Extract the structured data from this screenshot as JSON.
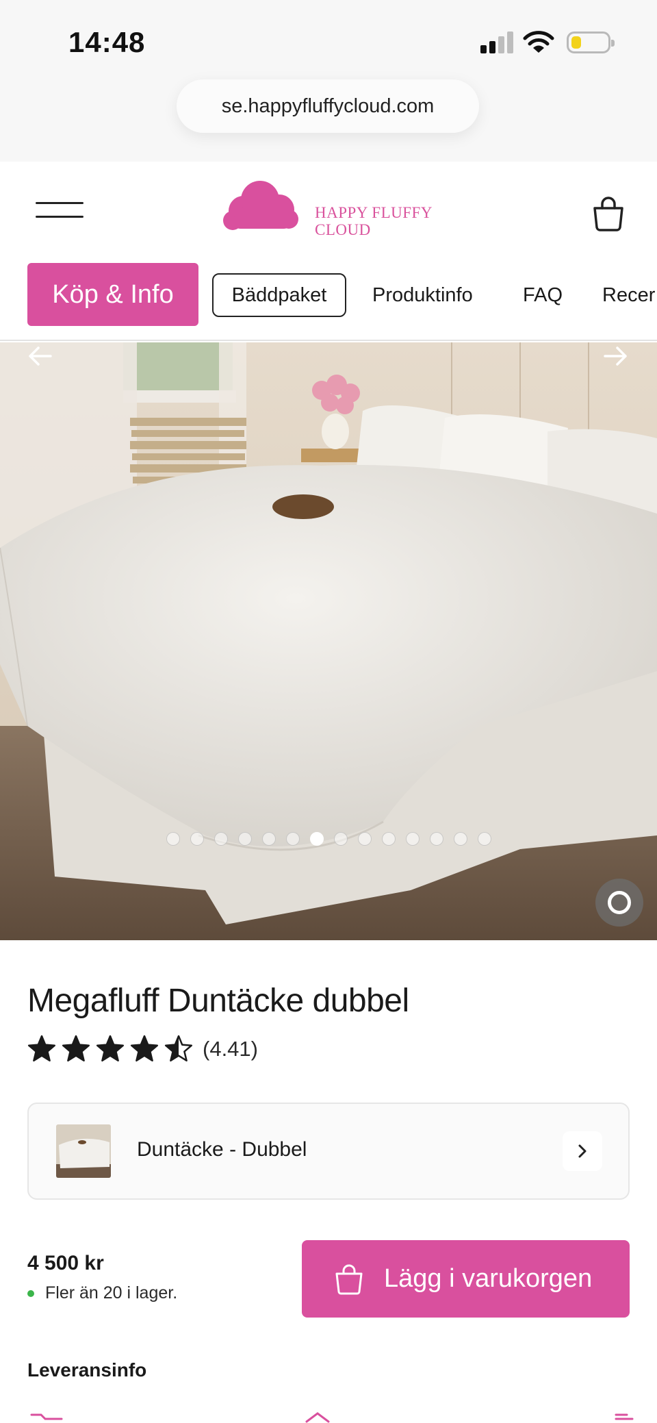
{
  "status_bar": {
    "time": "14:48"
  },
  "browser": {
    "url": "se.happyfluffycloud.com"
  },
  "header": {
    "logo_line1": "HAPPY FLUFFY",
    "logo_line2": "CLOUD",
    "brand_color": "#d9509e"
  },
  "tabs": [
    {
      "label": "Köp & Info",
      "state": "active"
    },
    {
      "label": "Bäddpaket",
      "state": "outlined"
    },
    {
      "label": "Produktinfo",
      "state": "normal"
    },
    {
      "label": "FAQ",
      "state": "normal"
    },
    {
      "label": "Recer",
      "state": "normal"
    }
  ],
  "gallery": {
    "total_images": 14,
    "active_index": 6
  },
  "product": {
    "title": "Megafluff Duntäcke dubbel",
    "rating_text": "(4.41)",
    "rating_value": 4.41,
    "variant_label": "Duntäcke - Dubbel",
    "price": "4 500 kr",
    "stock": "Fler än 20 i lager.",
    "stock_color": "#3bb54a",
    "cart_button": "Lägg i varukorgen"
  },
  "delivery": {
    "heading": "Leveransinfo"
  }
}
